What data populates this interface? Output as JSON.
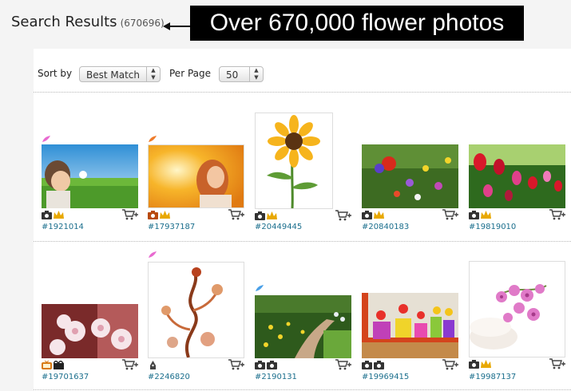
{
  "header": {
    "title": "Search Results",
    "count": "(670696)"
  },
  "callout": {
    "text": "Over 670,000 flower photos"
  },
  "controls": {
    "sort_label": "Sort by",
    "sort_value": "Best Match",
    "per_page_label": "Per Page",
    "per_page_value": "50"
  },
  "results": [
    {
      "id": "#1921014",
      "subject": "child blowing dandelion",
      "badge": "pink-flower-icon",
      "premium": true
    },
    {
      "id": "#17937187",
      "subject": "woman in sunlight",
      "badge": "orange-flower-icon",
      "premium": true
    },
    {
      "id": "#20449445",
      "subject": "sunflower",
      "badge": "",
      "premium": true
    },
    {
      "id": "#20840183",
      "subject": "wildflower meadow",
      "badge": "",
      "premium": true
    },
    {
      "id": "#19819010",
      "subject": "tulip field",
      "badge": "",
      "premium": true
    },
    {
      "id": "#19701637",
      "subject": "cherry blossoms",
      "badge": "",
      "premium": false
    },
    {
      "id": "#2246820",
      "subject": "floral ornament",
      "badge": "pink-flower-icon",
      "premium": false
    },
    {
      "id": "#2190131",
      "subject": "garden path",
      "badge": "blue-flower-icon",
      "premium": false
    },
    {
      "id": "#19969415",
      "subject": "flower pots",
      "badge": "",
      "premium": false
    },
    {
      "id": "#19987137",
      "subject": "orchids and towels",
      "badge": "",
      "premium": true
    }
  ],
  "colors": {
    "link": "#1a6e8c",
    "callout_bg": "#000000",
    "callout_text": "#ffffff"
  }
}
